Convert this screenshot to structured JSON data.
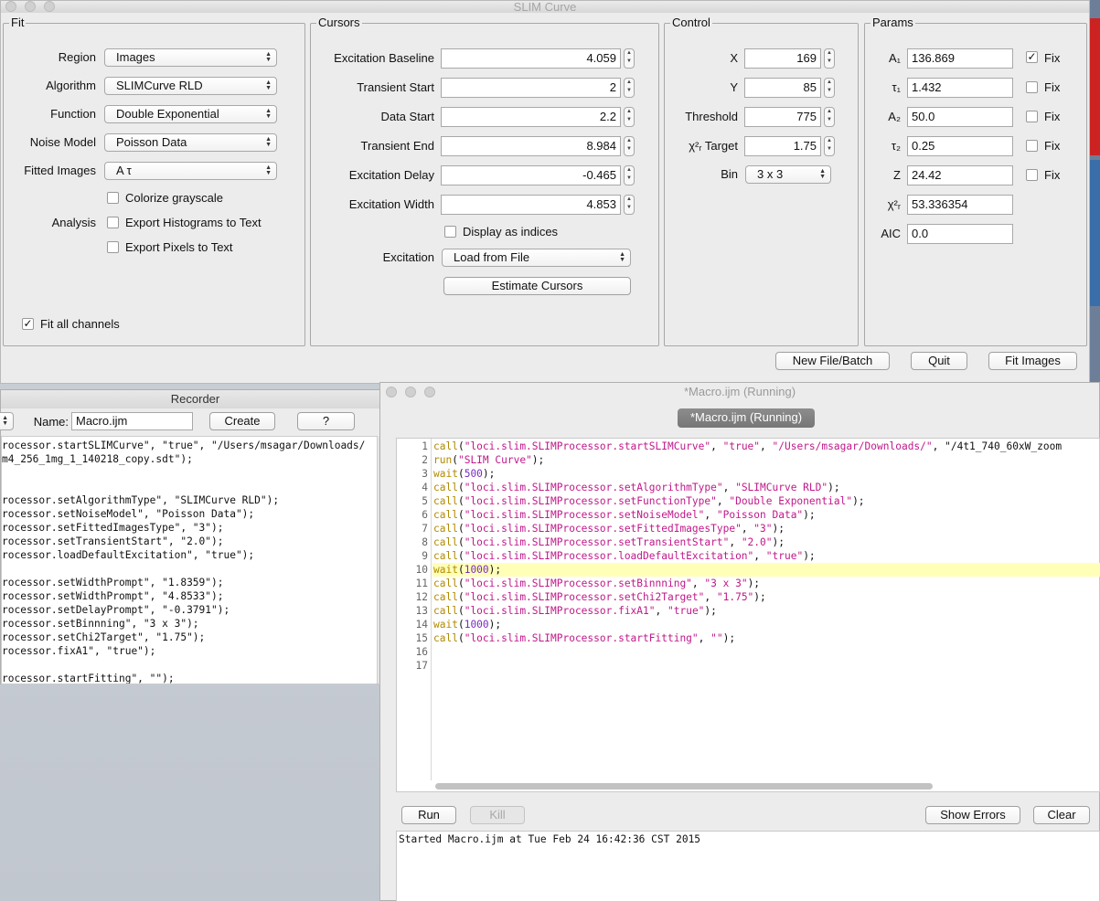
{
  "slim": {
    "title": "SLIM Curve",
    "fit": {
      "group_title": "Fit",
      "region_label": "Region",
      "region_value": "Images",
      "algorithm_label": "Algorithm",
      "algorithm_value": "SLIMCurve RLD",
      "function_label": "Function",
      "function_value": "Double Exponential",
      "noise_label": "Noise Model",
      "noise_value": "Poisson Data",
      "fitted_label": "Fitted Images",
      "fitted_value": "A τ",
      "colorize_label": "Colorize grayscale",
      "analysis_label": "Analysis",
      "export_hist_label": "Export Histograms to Text",
      "export_pixels_label": "Export Pixels to Text",
      "fit_all_label": "Fit all channels"
    },
    "cursors": {
      "group_title": "Cursors",
      "rows": [
        {
          "label": "Excitation Baseline",
          "value": "4.059"
        },
        {
          "label": "Transient Start",
          "value": "2"
        },
        {
          "label": "Data Start",
          "value": "2.2"
        },
        {
          "label": "Transient End",
          "value": "8.984"
        },
        {
          "label": "Excitation Delay",
          "value": "-0.465"
        },
        {
          "label": "Excitation Width",
          "value": "4.853"
        }
      ],
      "display_indices_label": "Display as indices",
      "excitation_label": "Excitation",
      "excitation_value": "Load from File",
      "estimate_label": "Estimate Cursors"
    },
    "control": {
      "group_title": "Control",
      "x_label": "X",
      "x_value": "169",
      "y_label": "Y",
      "y_value": "85",
      "threshold_label": "Threshold",
      "threshold_value": "775",
      "chi_label": "χ²ᵣ Target",
      "chi_value": "1.75",
      "bin_label": "Bin",
      "bin_value": "3 x 3"
    },
    "params": {
      "group_title": "Params",
      "rows": [
        {
          "label": "A₁",
          "value": "136.869",
          "fix": "Fix"
        },
        {
          "label": "τ₁",
          "value": "1.432",
          "fix": "Fix"
        },
        {
          "label": "A₂",
          "value": "50.0",
          "fix": "Fix"
        },
        {
          "label": "τ₂",
          "value": "0.25",
          "fix": "Fix"
        },
        {
          "label": "Z",
          "value": "24.42",
          "fix": "Fix"
        }
      ],
      "chi_label": "χ²ᵣ",
      "chi_value": "53.336354",
      "aic_label": "AIC",
      "aic_value": "0.0"
    },
    "buttons": {
      "new_file": "New File/Batch",
      "quit": "Quit",
      "fit": "Fit Images"
    }
  },
  "recorder": {
    "title": "Recorder",
    "name_label": "Name:",
    "name_value": "Macro.ijm",
    "create_label": "Create",
    "help_label": "?",
    "lines": [
      "rocessor.startSLIMCurve\", \"true\", \"/Users/msagar/Downloads/",
      "m4_256_1mg_1_140218_copy.sdt\");",
      "",
      "",
      "rocessor.setAlgorithmType\", \"SLIMCurve RLD\");",
      "rocessor.setNoiseModel\", \"Poisson Data\");",
      "rocessor.setFittedImagesType\", \"3\");",
      "rocessor.setTransientStart\", \"2.0\");",
      "rocessor.loadDefaultExcitation\", \"true\");",
      "",
      "rocessor.setWidthPrompt\", \"1.8359\");",
      "rocessor.setWidthPrompt\", \"4.8533\");",
      "rocessor.setDelayPrompt\", \"-0.3791\");",
      "rocessor.setBinnning\", \"3 x 3\");",
      "rocessor.setChi2Target\", \"1.75\");",
      "rocessor.fixA1\", \"true\");",
      "",
      "rocessor.startFitting\", \"\");"
    ]
  },
  "macro": {
    "title": "*Macro.ijm (Running)",
    "tab_label": "*Macro.ijm (Running)",
    "code": [
      {
        "n": "1",
        "t": "call(\"loci.slim.SLIMProcessor.startSLIMCurve\", \"true\", \"/Users/msagar/Downloads/\", \"/4t1_740_60xW_zoom"
      },
      {
        "n": "2",
        "t": "run(\"SLIM Curve\");"
      },
      {
        "n": "3",
        "t": "wait(500);"
      },
      {
        "n": "4",
        "t": "call(\"loci.slim.SLIMProcessor.setAlgorithmType\", \"SLIMCurve RLD\");"
      },
      {
        "n": "5",
        "t": "call(\"loci.slim.SLIMProcessor.setFunctionType\", \"Double Exponential\");"
      },
      {
        "n": "6",
        "t": "call(\"loci.slim.SLIMProcessor.setNoiseModel\", \"Poisson Data\");"
      },
      {
        "n": "7",
        "t": "call(\"loci.slim.SLIMProcessor.setFittedImagesType\", \"3\");"
      },
      {
        "n": "8",
        "t": "call(\"loci.slim.SLIMProcessor.setTransientStart\", \"2.0\");"
      },
      {
        "n": "9",
        "t": "call(\"loci.slim.SLIMProcessor.loadDefaultExcitation\", \"true\");"
      },
      {
        "n": "10",
        "t": "wait(1000);"
      },
      {
        "n": "11",
        "t": "call(\"loci.slim.SLIMProcessor.setBinnning\", \"3 x 3\");"
      },
      {
        "n": "12",
        "t": "call(\"loci.slim.SLIMProcessor.setChi2Target\", \"1.75\");"
      },
      {
        "n": "13",
        "t": "call(\"loci.slim.SLIMProcessor.fixA1\", \"true\");"
      },
      {
        "n": "14",
        "t": "wait(1000);"
      },
      {
        "n": "15",
        "t": "call(\"loci.slim.SLIMProcessor.startFitting\", \"\");"
      },
      {
        "n": "16",
        "t": ""
      },
      {
        "n": "17",
        "t": ""
      }
    ],
    "highlight_line": "10",
    "run_label": "Run",
    "kill_label": "Kill",
    "show_errors_label": "Show Errors",
    "clear_label": "Clear",
    "console": "Started Macro.ijm at Tue Feb 24 16:42:36 CST 2015"
  }
}
